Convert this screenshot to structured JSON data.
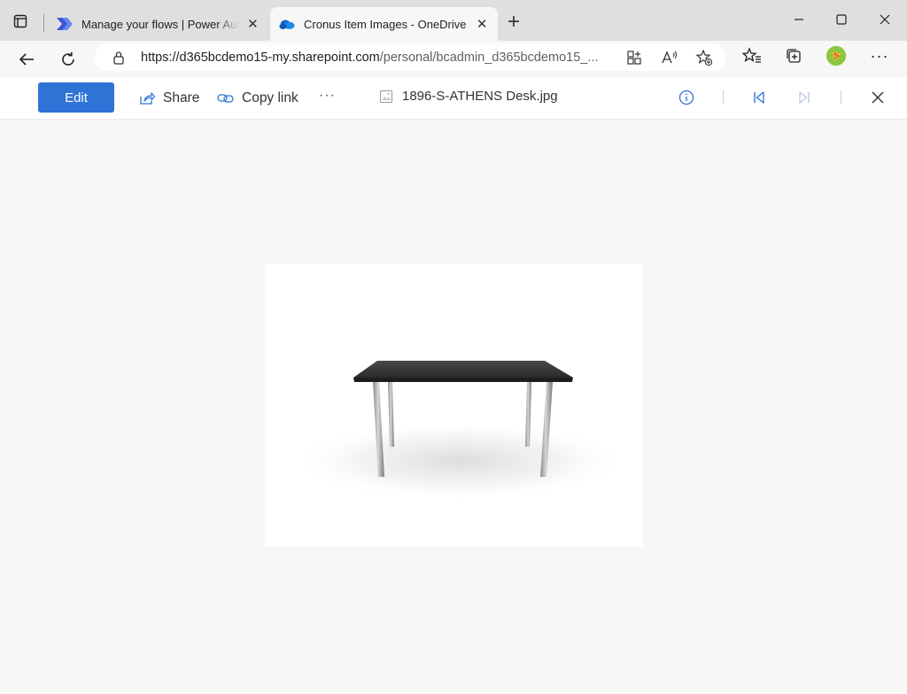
{
  "browser": {
    "tabs": [
      {
        "label": "Manage your flows | Power Automate",
        "icon": "power-automate-icon"
      },
      {
        "label": "Cronus Item Images - OneDrive",
        "icon": "onedrive-icon",
        "active": true
      }
    ],
    "address": {
      "url_host": "https://d365bcdemo15-my.sharepoint.com",
      "url_path": "/personal/bcadmin_d365bcdemo15_..."
    }
  },
  "viewer": {
    "edit_label": "Edit",
    "share_label": "Share",
    "copy_link_label": "Copy link",
    "more_label": "···",
    "file_name": "1896-S-ATHENS Desk.jpg"
  },
  "colors": {
    "accent": "#2f73d6",
    "canvas": "#f8f7f5",
    "tab_bar": "#dfdfdf"
  }
}
